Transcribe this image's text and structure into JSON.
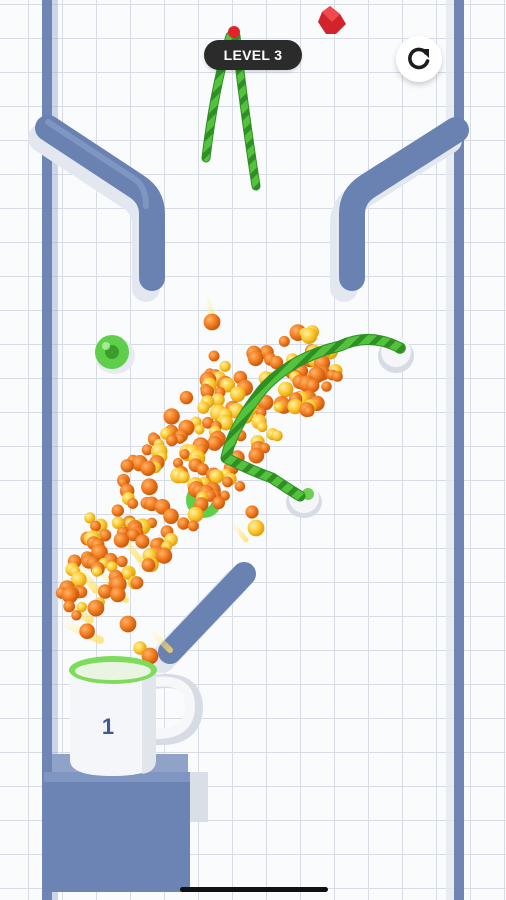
{
  "hud": {
    "level_label": "LEVEL 3",
    "restart_icon": "restart-icon"
  },
  "cup": {
    "number": "1",
    "rim_color": "#7ddc5a"
  },
  "colors": {
    "wall": "#6f86b4",
    "rope": "#4cc23a",
    "ball_orange": "#f07a1c",
    "ball_yellow": "#fcc72c"
  }
}
